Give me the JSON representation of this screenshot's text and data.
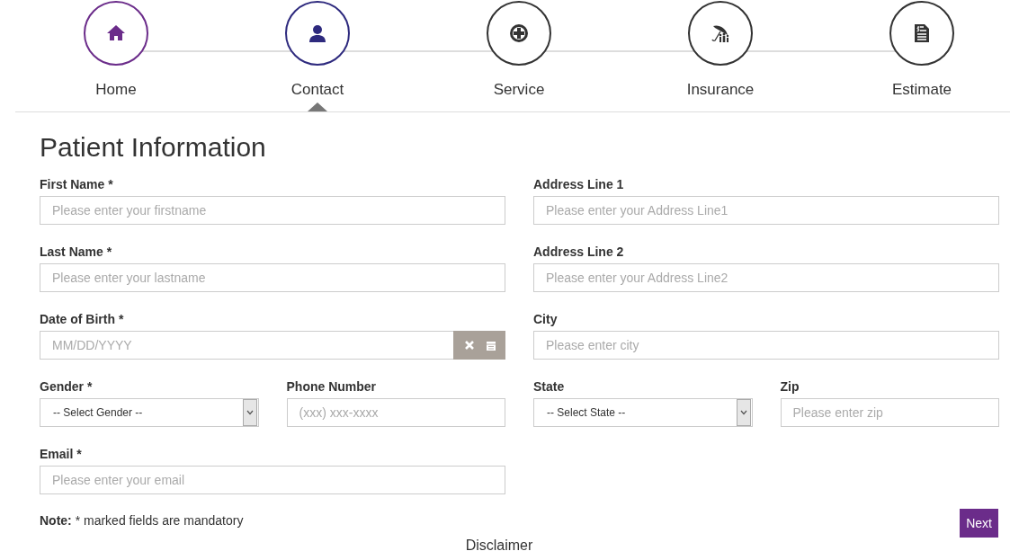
{
  "steps": [
    {
      "label": "Home",
      "kind": "home",
      "completed": true,
      "selected": false
    },
    {
      "label": "Contact",
      "kind": "person",
      "completed": false,
      "selected": true
    },
    {
      "label": "Service",
      "kind": "service",
      "completed": false,
      "selected": false
    },
    {
      "label": "Insurance",
      "kind": "umbrella",
      "completed": false,
      "selected": false
    },
    {
      "label": "Estimate",
      "kind": "document",
      "completed": false,
      "selected": false
    }
  ],
  "form": {
    "title": "Patient Information",
    "left_column": [
      [
        {
          "kind": "text",
          "label": "First Name *",
          "placeholder": "Please enter your firstname"
        }
      ],
      [
        {
          "kind": "text",
          "label": "Last Name *",
          "placeholder": "Please enter your lastname"
        }
      ],
      [
        {
          "kind": "date",
          "label": "Date of Birth *",
          "placeholder": "MM/DD/YYYY"
        }
      ],
      [
        {
          "kind": "select",
          "label": "Gender *",
          "value": "-- Select Gender --"
        },
        {
          "kind": "text",
          "label": "Phone Number",
          "placeholder": "(xxx) xxx-xxxx"
        }
      ],
      [
        {
          "kind": "text",
          "label": "Email *",
          "placeholder": "Please enter your email"
        }
      ]
    ],
    "right_column": [
      [
        {
          "kind": "text",
          "label": "Address Line 1",
          "placeholder": "Please enter your Address Line1"
        }
      ],
      [
        {
          "kind": "text",
          "label": "Address Line 2",
          "placeholder": "Please enter your Address Line2"
        }
      ],
      [
        {
          "kind": "text",
          "label": "City",
          "placeholder": "Please enter city"
        }
      ],
      [
        {
          "kind": "select",
          "label": "State",
          "value": "-- Select State --"
        },
        {
          "kind": "text",
          "label": "Zip",
          "placeholder": "Please enter zip"
        }
      ]
    ],
    "note": "**Note:** * marked fields are mandatory",
    "next_button": "Next",
    "footer_heading": "Disclaimer"
  }
}
